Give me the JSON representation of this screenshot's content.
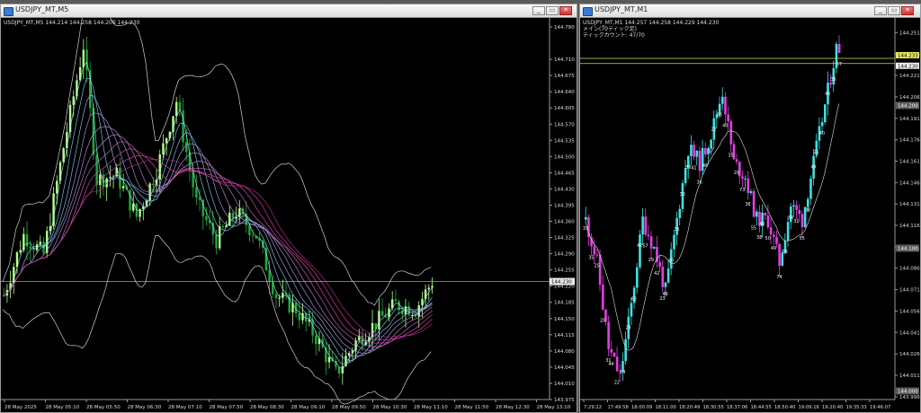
{
  "left_window": {
    "title": "USDJPY_MT,M5",
    "info_line": "USDJPY_MT,M5  144.214 144.258 144.200 144.230",
    "current_price_label": "144.230",
    "price_axis": [
      "144.780",
      "144.710",
      "144.675",
      "144.640",
      "144.605",
      "144.570",
      "144.535",
      "144.500",
      "144.465",
      "144.430",
      "144.395",
      "144.360",
      "144.325",
      "144.290",
      "144.255",
      "144.220",
      "144.185",
      "144.150",
      "144.115",
      "144.080",
      "144.045",
      "144.010",
      "143.975"
    ],
    "time_axis": [
      "28 May 2025",
      "28 May 05:10",
      "28 May 05:50",
      "28 May 06:30",
      "28 May 07:10",
      "28 May 07:50",
      "28 May 08:30",
      "28 May 09:10",
      "28 May 09:50",
      "28 May 10:30",
      "28 May 11:10",
      "28 May 11:50",
      "28 May 12:30",
      "28 May 13:10"
    ]
  },
  "right_window": {
    "title": "USDJPY_MT,M1",
    "info_line": "USDJPY_MT,M1  144.257 144.258 144.229 144.230",
    "info_line2": "メイン(70ティック足)",
    "info_line3": "ティックカウント: 47/70",
    "current_price_label": "144.230",
    "bid_label": "144.233",
    "price_axis": [
      "144.251",
      "144.236",
      "144.221",
      "144.206",
      "144.191",
      "144.176",
      "144.161",
      "144.146",
      "144.131",
      "144.116",
      "144.101",
      "144.086",
      "144.071",
      "144.056",
      "144.041",
      "144.026",
      "144.011",
      "143.996"
    ],
    "highlighted_prices": [
      "144.200",
      "144.100",
      "144.000"
    ],
    "time_axis": [
      "7:29:22",
      "17:49:58",
      "18:00:09",
      "18:11:00",
      "18:20:49",
      "18:30:55",
      "18:37:06",
      "18:44:55",
      "18:50:40",
      "19:09:16",
      "19:20:40",
      "19:35:33",
      "19:46:07"
    ],
    "tick_counts": [
      "33",
      "35",
      "25",
      "20",
      "31",
      "44",
      "22",
      "14",
      "28",
      "62",
      "42",
      "57",
      "29",
      "42",
      "23",
      "46",
      "40",
      "35",
      "30",
      "33",
      "41",
      "36",
      "46",
      "17",
      "22",
      "56",
      "40",
      "35",
      "29",
      "73",
      "36",
      "55",
      "38",
      "40",
      "50",
      "49",
      "74",
      "26",
      "34",
      "31",
      "55",
      "38",
      "49",
      "21",
      "40",
      "46",
      "36",
      "57"
    ]
  },
  "window_controls": {
    "minimize": "_",
    "restore": "▭",
    "close": "✕"
  },
  "colors": {
    "candle_bull": "#b5ff8a",
    "candle_bear": "#1faa3a",
    "right_bull": "#3ee0e0",
    "right_bear": "#e040e0",
    "bands": "#d0d0d0",
    "ribbon_top": "#8ff0ff",
    "ribbon_bottom": "#ff40c0"
  }
}
